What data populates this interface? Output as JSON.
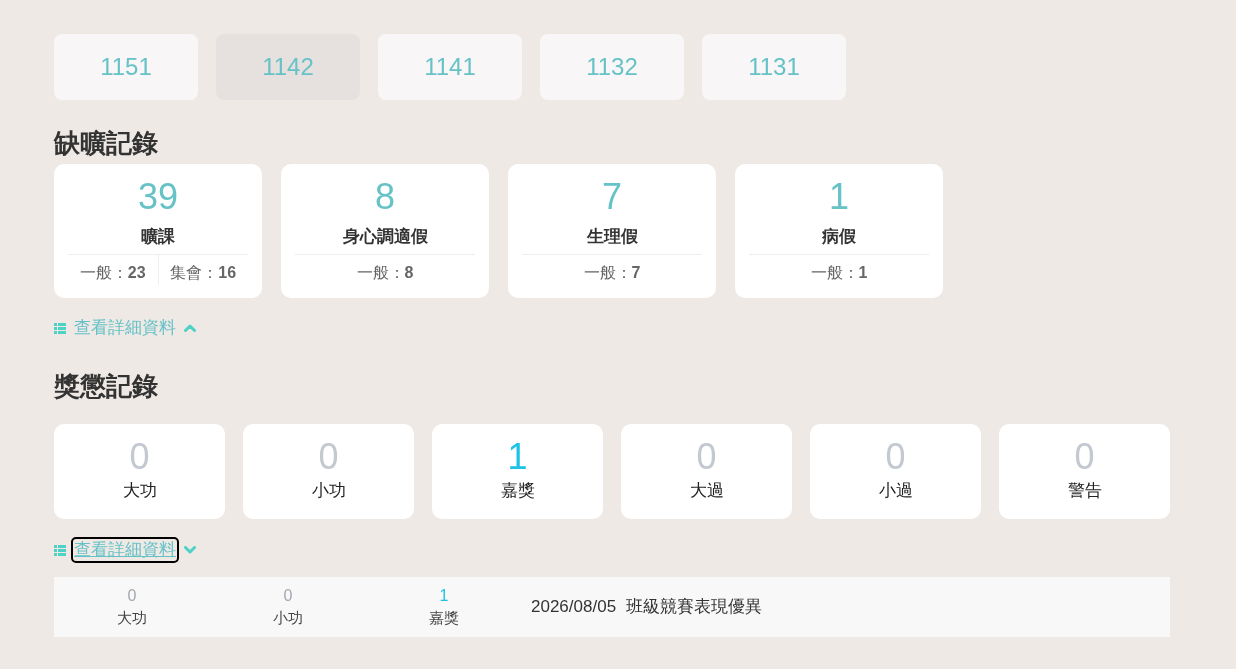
{
  "semester_tabs": [
    {
      "label": "1151",
      "selected": false
    },
    {
      "label": "1142",
      "selected": true
    },
    {
      "label": "1141",
      "selected": false
    },
    {
      "label": "1132",
      "selected": false
    },
    {
      "label": "1131",
      "selected": false
    }
  ],
  "attendance": {
    "title": "缺曠記錄",
    "cards": [
      {
        "count": "39",
        "label": "曠課",
        "breakdown": [
          "一般：**23**",
          "集會：**16**"
        ]
      },
      {
        "count": "8",
        "label": "身心調適假",
        "breakdown": [
          "一般：**8**"
        ]
      },
      {
        "count": "7",
        "label": "生理假",
        "breakdown": [
          "一般：**7**"
        ]
      },
      {
        "count": "1",
        "label": "病假",
        "breakdown": [
          "一般：**1**"
        ]
      }
    ],
    "details_link": {
      "label": "查看詳細資料",
      "expanded": false,
      "focused": false
    }
  },
  "rewards": {
    "title": "獎懲記錄",
    "cards": [
      {
        "count": "0",
        "label": "大功",
        "dimmed": true
      },
      {
        "count": "0",
        "label": "小功",
        "dimmed": true
      },
      {
        "count": "1",
        "label": "嘉獎",
        "dimmed": false
      },
      {
        "count": "0",
        "label": "大過",
        "dimmed": true
      },
      {
        "count": "0",
        "label": "小過",
        "dimmed": true
      },
      {
        "count": "0",
        "label": "警告",
        "dimmed": true
      }
    ],
    "details_link": {
      "label": "查看詳細資料",
      "expanded": true,
      "focused": true
    },
    "details": [
      {
        "counts": [
          {
            "value": "0",
            "label": "大功",
            "dimmed": true
          },
          {
            "value": "0",
            "label": "小功",
            "dimmed": true
          },
          {
            "value": "1",
            "label": "嘉獎",
            "dimmed": false
          }
        ],
        "date": "2026/08/05",
        "description": "班級競賽表現優異"
      }
    ]
  }
}
